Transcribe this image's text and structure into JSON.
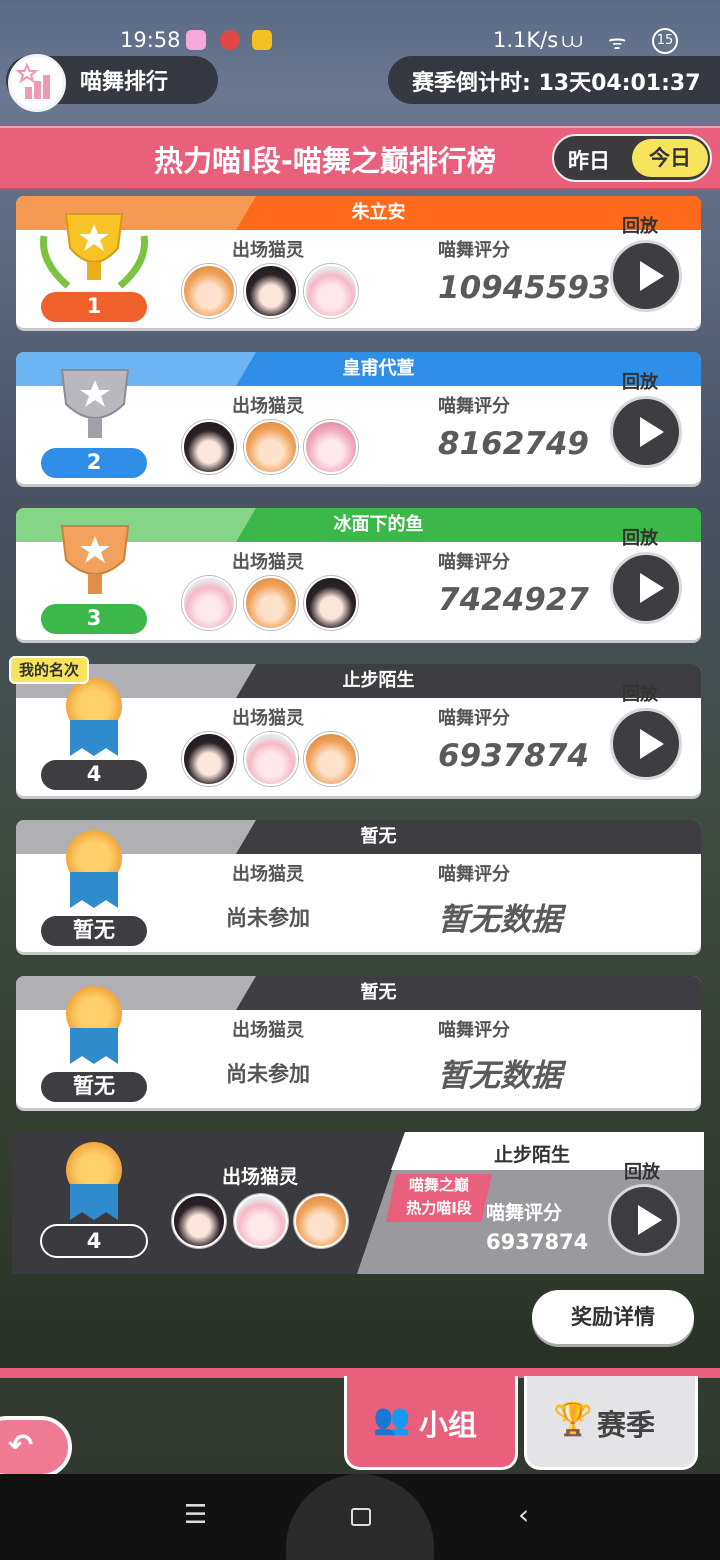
{
  "status_bar": {
    "time": "19:58",
    "network_speed": "1.1K/s",
    "battery": "15"
  },
  "header": {
    "title": "喵舞排行",
    "countdown": "赛季倒计时: 13天04:01:37"
  },
  "banner": {
    "title": "热力喵I段-喵舞之巅排行榜",
    "toggle_yesterday": "昨日",
    "toggle_today": "今日"
  },
  "labels": {
    "characters": "出场猫灵",
    "score": "喵舞评分",
    "replay": "回放",
    "my_rank": "我的名次",
    "not_joined": "尚未参加",
    "no_data": "暂无数据"
  },
  "entries": [
    {
      "rank": "1",
      "name": "朱立安",
      "score": "10945593",
      "bar_color": "#f47a30",
      "bar_hi": "#ff6a1c",
      "pill_color": "#f0602a"
    },
    {
      "rank": "2",
      "name": "皇甫代萱",
      "score": "8162749",
      "bar_color": "#5aa8f0",
      "bar_hi": "#2f8ee8",
      "pill_color": "#2f8ee8"
    },
    {
      "rank": "3",
      "name": "冰面下的鱼",
      "score": "7424927",
      "bar_color": "#7ad07a",
      "bar_hi": "#3cb84a",
      "pill_color": "#3cb84a"
    },
    {
      "rank": "4",
      "name": "止步陌生",
      "score": "6937874",
      "bar_color": "#b0b0b4",
      "bar_hi": "#3e3e42",
      "pill_color": "#3e3e42"
    },
    {
      "rank": "暂无",
      "name": "暂无"
    },
    {
      "rank": "暂无",
      "name": "暂无"
    }
  ],
  "my_summary": {
    "rank": "4",
    "name": "止步陌生",
    "league_line1": "喵舞之巅",
    "league_line2": "热力喵I段",
    "score": "6937874"
  },
  "reward_button": "奖励详情",
  "tabs": {
    "group": "小组",
    "season": "赛季"
  }
}
